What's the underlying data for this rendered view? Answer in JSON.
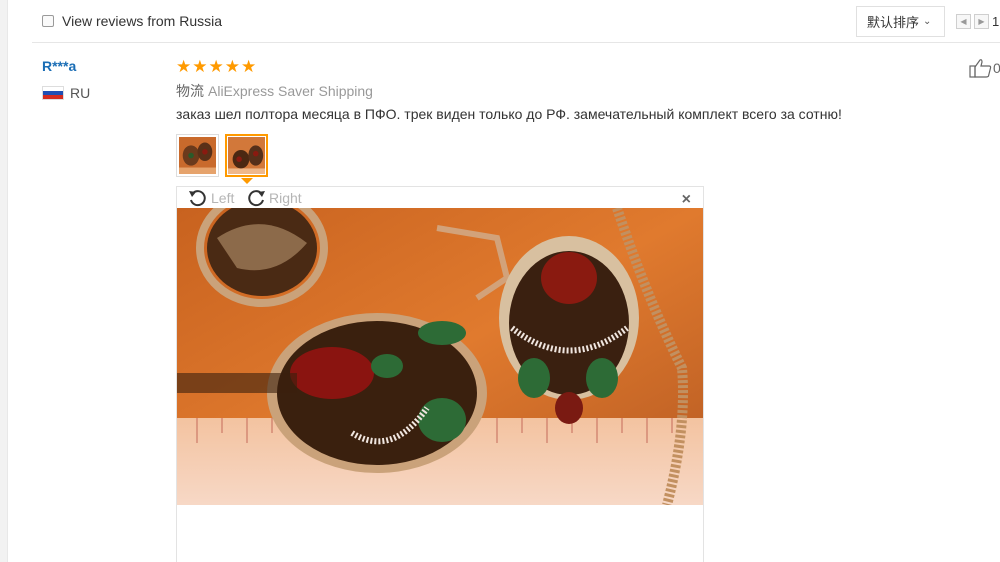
{
  "filter": {
    "label": "View reviews from Russia"
  },
  "sort": {
    "label": "默认排序"
  },
  "pager": {
    "current_page": "1"
  },
  "review": {
    "reviewer": "R***a",
    "country": "RU",
    "rating": 5,
    "shipping_label": "物流",
    "shipping_method": "AliExpress Saver Shipping",
    "text": "заказ шел полтора месяца в ПФО. трек виден только до РФ. замечательный комплект всего за сотню!",
    "thumbnail_count": 2,
    "active_thumbnail": 2
  },
  "viewer": {
    "rotate_left": "Left",
    "rotate_right": "Right",
    "close": "×"
  },
  "like": {
    "count": "0"
  },
  "colors": {
    "accent": "#ff9a00",
    "link": "#1a6db5",
    "muted": "#999999"
  }
}
